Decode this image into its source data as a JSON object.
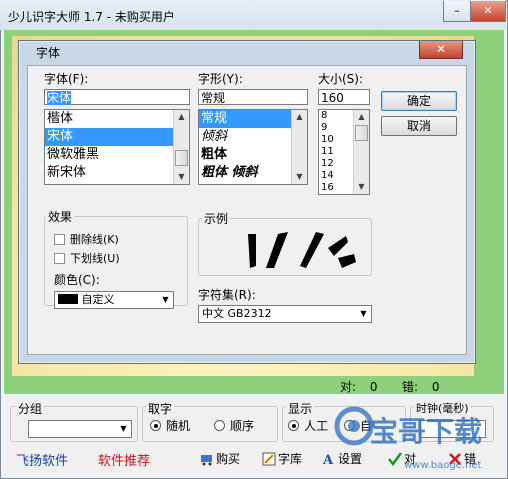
{
  "window": {
    "title": "少儿识字大师 1.7 - 未购买用户"
  },
  "dialog": {
    "title": "字体",
    "font_label": "字体(F):",
    "font_value": "宋体",
    "font_list": [
      "楷体",
      "宋体",
      "微软雅黑",
      "新宋体"
    ],
    "style_label": "字形(Y):",
    "style_value": "常规",
    "style_list": [
      "常规",
      "倾斜",
      "粗体",
      "粗体 倾斜"
    ],
    "size_label": "大小(S):",
    "size_value": "160",
    "size_list": [
      "8",
      "9",
      "10",
      "11",
      "12",
      "14",
      "16"
    ],
    "ok_label": "确定",
    "cancel_label": "取消",
    "effects_label": "效果",
    "strike_label": "删除线(K)",
    "underline_label": "下划线(U)",
    "color_label": "颜色(C):",
    "color_value": "自定义",
    "sample_label": "示例",
    "charset_label": "字符集(R):",
    "charset_value": "中文 GB2312"
  },
  "score": {
    "right_label": "对:",
    "right_value": "0",
    "wrong_label": "错:",
    "wrong_value": "0"
  },
  "bottom": {
    "group_label": "分组",
    "pick_label": "取字",
    "pick_random": "随机",
    "pick_sequence": "顺序",
    "display_label": "显示",
    "display_manual": "人工",
    "display_auto": "自",
    "clock_label": "时钟(毫秒)",
    "link_feiyang": "飞扬软件",
    "link_recommend": "软件推荐",
    "tool_buy": "购买",
    "tool_library": "字库",
    "tool_settings": "设置",
    "tool_right": "对",
    "tool_wrong": "错",
    "watermark": "宝哥下载",
    "watermark_url": "www.baoge.net"
  },
  "colors": {
    "green": "#8ed07c",
    "select_blue": "#3399ff",
    "link_blue": "#1a3fb0",
    "link_red": "#cc1111",
    "watermark_blue": "#2b6fbf"
  }
}
